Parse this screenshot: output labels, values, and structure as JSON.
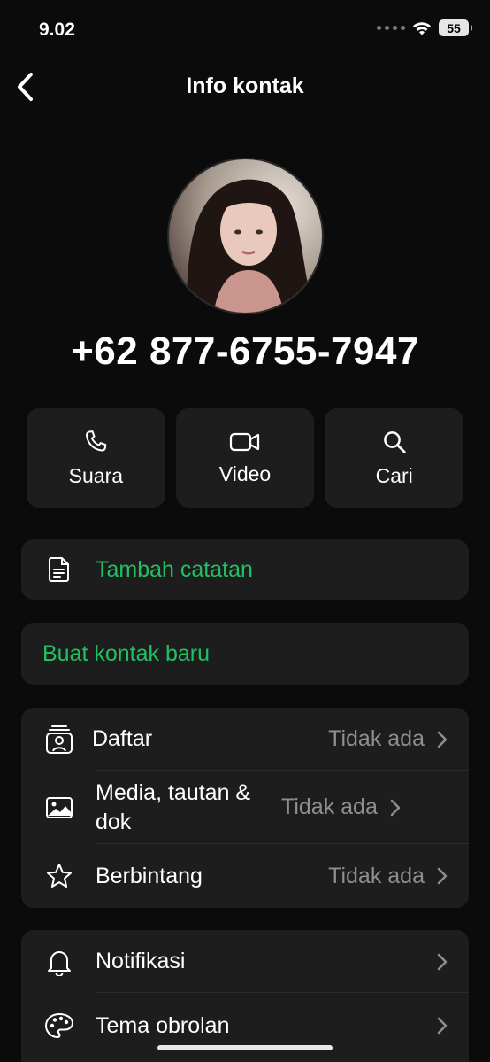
{
  "status_bar": {
    "time": "9.02",
    "battery": "55"
  },
  "nav": {
    "title": "Info kontak"
  },
  "contact": {
    "phone": "+62 877-6755-7947"
  },
  "actions": [
    {
      "label": "Suara",
      "icon": "phone-icon"
    },
    {
      "label": "Video",
      "icon": "video-icon"
    },
    {
      "label": "Cari",
      "icon": "search-icon"
    }
  ],
  "add_note": {
    "label": "Tambah catatan",
    "icon": "note-icon"
  },
  "new_contact": {
    "label": "Buat kontak baru"
  },
  "info_list": [
    {
      "label": "Daftar",
      "value": "Tidak ada",
      "icon": "list-contact-icon"
    },
    {
      "label": "Media, tautan & dok",
      "value": "Tidak ada",
      "icon": "image-icon"
    },
    {
      "label": "Berbintang",
      "value": "Tidak ada",
      "icon": "star-icon"
    }
  ],
  "settings_list": [
    {
      "label": "Notifikasi",
      "icon": "bell-icon"
    },
    {
      "label": "Tema obrolan",
      "icon": "palette-icon"
    }
  ],
  "colors": {
    "accent": "#21c063",
    "background": "#0b0b0b",
    "card": "#1d1d1d",
    "muted": "#8e8e8e"
  }
}
